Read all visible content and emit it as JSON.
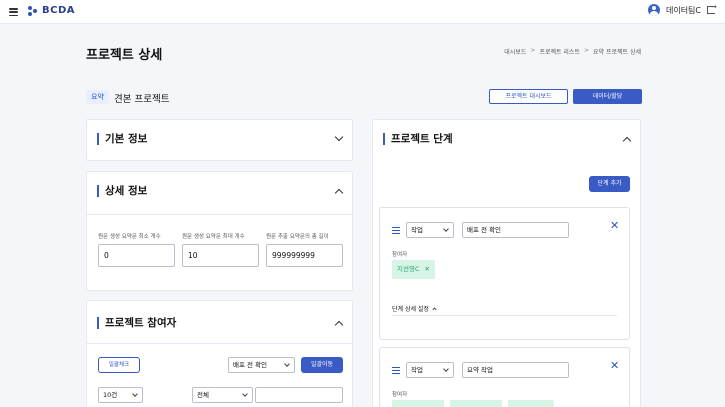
{
  "header": {
    "logo_text": "BCDA",
    "user_name": "데이터팀C"
  },
  "page": {
    "title": "프로젝트 상세",
    "breadcrumb": [
      "대시보드",
      "프로젝트 리스트",
      "요약 프로젝트 상세"
    ],
    "breadcrumb_sep": ">"
  },
  "project": {
    "badge": "요약",
    "name": "견본 프로젝트",
    "dashboard_button": "프로젝트 대시보드",
    "data_button": "데이터/할당"
  },
  "basic_info": {
    "title": "기본 정보"
  },
  "detail_info": {
    "title": "상세 정보",
    "fields": [
      {
        "label": "원문 생성 요약문 최소 개수",
        "value": "0"
      },
      {
        "label": "원문 생성 요약문 최대 개수",
        "value": "10"
      },
      {
        "label": "원문 추출 요약문의 총 길이",
        "value": "999999999"
      }
    ]
  },
  "participants": {
    "title": "프로젝트 참여자",
    "bulk_check_button": "일괄체크",
    "stage_select": "배포 전 확인",
    "bulk_move_button": "일괄이동",
    "page_size_select": "10건",
    "filter_select": "전체",
    "search_value": ""
  },
  "stages": {
    "title": "프로젝트 단계",
    "add_button": "단계 추가",
    "items": [
      {
        "type": "작업",
        "name": "배포 전 확인",
        "participants_label": "참여자",
        "participants": [
          "지선영C"
        ],
        "detail_label": "단계 상세 설정"
      },
      {
        "type": "작업",
        "name": "요약 작업",
        "participants_label": "참여자"
      }
    ]
  },
  "colors": {
    "accent": "#3a5bc5",
    "chip_bg": "#d7f5e6",
    "chip_text": "#2f9e6a"
  }
}
